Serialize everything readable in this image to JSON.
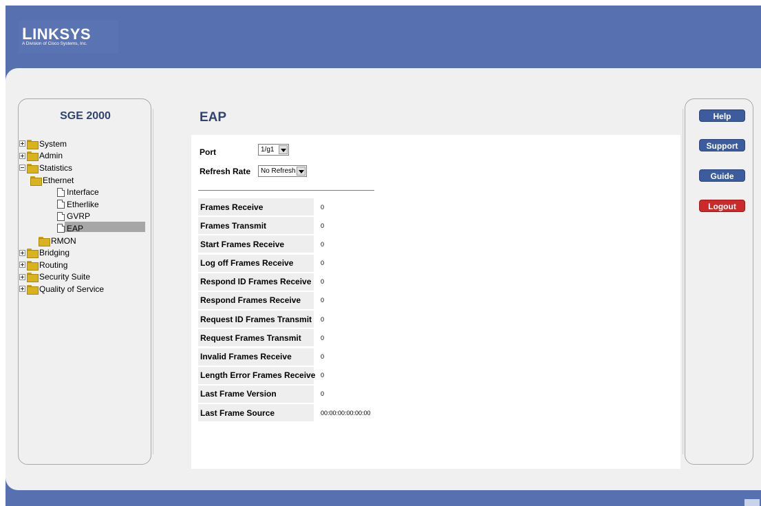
{
  "brand": {
    "name_first_letter": "L",
    "name_rest": "INKSYS",
    "tagline": "A Division of Cisco Systems, Inc."
  },
  "device": {
    "title": "SGE 2000"
  },
  "tree": [
    {
      "label": "System",
      "expander": "plus",
      "icon": "folder"
    },
    {
      "label": "Admin",
      "expander": "plus",
      "icon": "folder"
    },
    {
      "label": "Statistics",
      "expander": "minus",
      "icon": "folder-open"
    },
    {
      "label": "Ethernet",
      "expander": "none",
      "icon": "folder-open"
    },
    {
      "label": "Interface",
      "expander": "none",
      "icon": "document"
    },
    {
      "label": "Etherlike",
      "expander": "none",
      "icon": "document"
    },
    {
      "label": "GVRP",
      "expander": "none",
      "icon": "document"
    },
    {
      "label": "EAP",
      "expander": "none",
      "icon": "document",
      "selected": true
    },
    {
      "label": "RMON",
      "expander": "none",
      "icon": "folder"
    },
    {
      "label": "Bridging",
      "expander": "plus",
      "icon": "folder"
    },
    {
      "label": "Routing",
      "expander": "plus",
      "icon": "folder"
    },
    {
      "label": "Security Suite",
      "expander": "plus",
      "icon": "folder"
    },
    {
      "label": "Quality of Service",
      "expander": "plus",
      "icon": "folder"
    }
  ],
  "page": {
    "title": "EAP",
    "port_label": "Port",
    "port_value": "1/g1",
    "refresh_label": "Refresh Rate",
    "refresh_value": "No Refresh"
  },
  "stats": [
    {
      "label": "Frames Receive",
      "value": "0"
    },
    {
      "label": "Frames Transmit",
      "value": "0"
    },
    {
      "label": "Start Frames Receive",
      "value": "0"
    },
    {
      "label": "Log off Frames Receive",
      "value": "0"
    },
    {
      "label": "Respond ID Frames Receive",
      "value": "0"
    },
    {
      "label": "Respond Frames Receive",
      "value": "0"
    },
    {
      "label": "Request ID Frames Transmit",
      "value": "0"
    },
    {
      "label": "Request Frames Transmit",
      "value": "0"
    },
    {
      "label": "Invalid Frames Receive",
      "value": "0"
    },
    {
      "label": "Length Error Frames Receive",
      "value": "0"
    },
    {
      "label": "Last Frame Version",
      "value": "0"
    },
    {
      "label": "Last Frame Source",
      "value": "00:00:00:00:00:00"
    }
  ],
  "nav": {
    "help": "Help",
    "support": "Support",
    "guide": "Guide",
    "logout": "Logout"
  },
  "colors": {
    "header_blue": "#5670b0",
    "title_blue": "#2f4472",
    "button_blue": "#3d5c9e",
    "logout_red": "#cc2a2a"
  }
}
